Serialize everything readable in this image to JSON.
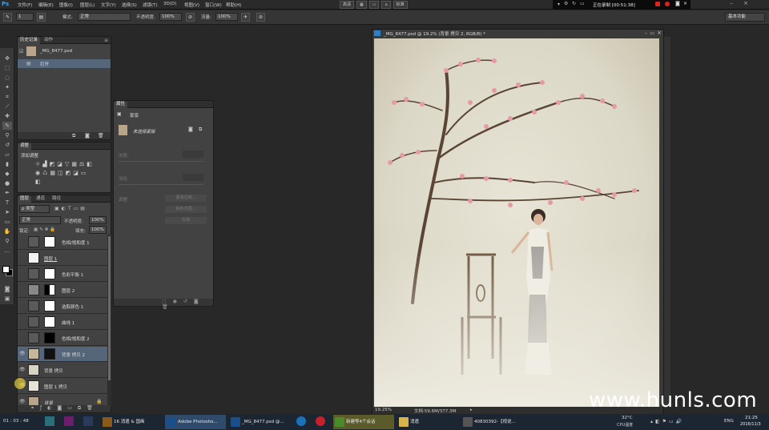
{
  "menubar": {
    "logo": "Ps",
    "items": [
      "文件(F)",
      "编辑(E)",
      "图像(I)",
      "图层(L)",
      "文字(Y)",
      "选择(S)",
      "滤镜(T)",
      "3D(D)",
      "视图(V)",
      "窗口(W)",
      "帮助(H)"
    ],
    "center_buttons": [
      "高清",
      "标准"
    ],
    "recording": "正在录制 [00:51:38]"
  },
  "options": {
    "mode_label": "模式:",
    "mode_value": "正常",
    "opacity_label": "不透明度:",
    "opacity_value": "100%",
    "flow_label": "流量:",
    "flow_value": "100%",
    "brush_size": "1",
    "workspace": "基本功能"
  },
  "history": {
    "tabs": [
      "历史记录",
      "动作"
    ],
    "snapshot": "_MG_8477.psd",
    "step": "打开"
  },
  "adjustments": {
    "tabs": [
      "调整"
    ],
    "title": "添加调整"
  },
  "properties": {
    "tabs": [
      "属性"
    ],
    "subtitle": "蒙版",
    "mask_label": "未选择蒙版",
    "density_label": "浓度:",
    "feather_label": "羽化:",
    "refine_label": "调整:",
    "buttons": [
      "蒙版边缘...",
      "颜色范围...",
      "反相"
    ]
  },
  "layers": {
    "tabs": [
      "图层",
      "通道",
      "路径"
    ],
    "kind": "ρ 类型",
    "blend": "正常",
    "opacity_label": "不透明度:",
    "opacity_value": "100%",
    "lock_label": "锁定:",
    "fill_label": "填充:",
    "fill_value": "100%",
    "rows": [
      {
        "name": "色相/饱和度 1",
        "visible": false,
        "selected": false
      },
      {
        "name": "图层 1",
        "visible": false,
        "selected": false
      },
      {
        "name": "色彩平衡 1",
        "visible": false,
        "selected": false
      },
      {
        "name": "图层 2",
        "visible": false,
        "selected": false
      },
      {
        "name": "选取颜色 1",
        "visible": false,
        "selected": false
      },
      {
        "name": "曲线 1",
        "visible": false,
        "selected": false
      },
      {
        "name": "色相/饱和度 2",
        "visible": false,
        "selected": false
      },
      {
        "name": "背景 拷贝 2",
        "visible": true,
        "selected": true
      },
      {
        "name": "背景 拷贝",
        "visible": true,
        "selected": false
      },
      {
        "name": "图层 1 拷贝",
        "visible": true,
        "selected": false
      },
      {
        "name": "背景",
        "visible": true,
        "selected": false
      }
    ]
  },
  "document": {
    "title": "_MG_8477.psd @ 19.2% (背景 拷贝 2, RGB/8) *",
    "zoom": "19.25%",
    "doc_size": "文档:59.6M/377.3M"
  },
  "taskbar": {
    "items": [
      "16 消遣 & 国画",
      "Adobe Photosho...",
      "_MG_8477.psd @...",
      "新建等4个会话",
      "消遣",
      "40830392-【视说..."
    ],
    "time": "21:25",
    "date": "2016/11/3",
    "temp": "32°C",
    "cpu": "CPU温度",
    "lang": "ENG",
    "clock_left": "01 : 03 : 48"
  },
  "watermark": "www.hunls.com"
}
